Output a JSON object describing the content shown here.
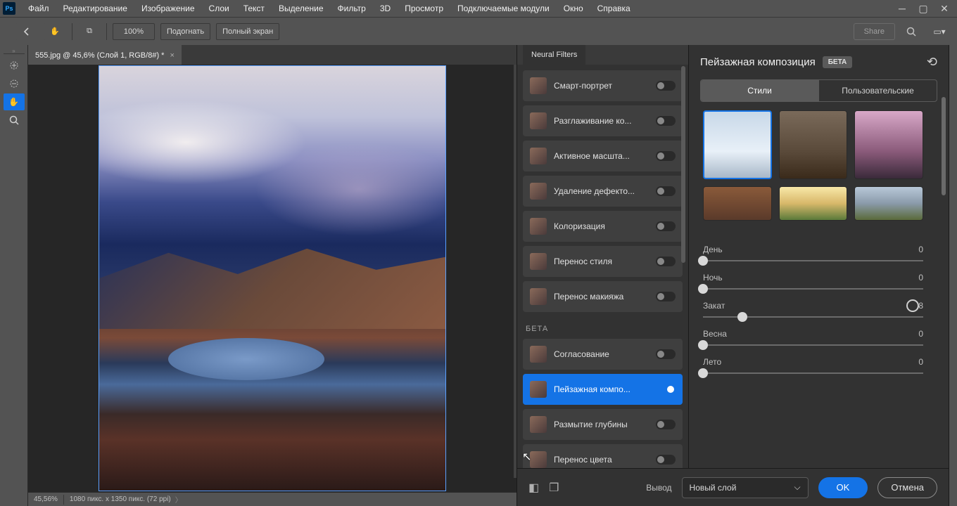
{
  "menu": {
    "items": [
      "Файл",
      "Редактирование",
      "Изображение",
      "Слои",
      "Текст",
      "Выделение",
      "Фильтр",
      "3D",
      "Просмотр",
      "Подключаемые модули",
      "Окно",
      "Справка"
    ]
  },
  "optbar": {
    "zoom": "100%",
    "fit": "Подогнать",
    "full": "Полный экран",
    "share": "Share"
  },
  "tab": {
    "title": "555.jpg @ 45,6% (Слой 1, RGB/8#) *"
  },
  "status": {
    "zoom": "45,56%",
    "dims": "1080 пикс. x 1350 пикс. (72 ppi)"
  },
  "nf": {
    "panel_title": "Neural Filters",
    "items": [
      {
        "label": "Смарт-портрет"
      },
      {
        "label": "Разглаживание ко..."
      },
      {
        "label": "Активное масшта..."
      },
      {
        "label": "Удаление дефекто..."
      },
      {
        "label": "Колоризация"
      },
      {
        "label": "Перенос стиля"
      },
      {
        "label": "Перенос макияжа"
      }
    ],
    "section": "БЕТА",
    "beta_items": [
      {
        "label": "Согласование"
      },
      {
        "label": "Пейзажная компо...",
        "on": true
      },
      {
        "label": "Размытие глубины"
      },
      {
        "label": "Перенос цвета"
      }
    ]
  },
  "right": {
    "title": "Пейзажная композиция",
    "beta": "БЕТА",
    "tabs": {
      "styles": "Стили",
      "custom": "Пользовательские"
    },
    "sliders": [
      {
        "label": "День",
        "value": "0",
        "pos": 0
      },
      {
        "label": "Ночь",
        "value": "0",
        "pos": 0
      },
      {
        "label": "Закат",
        "value": "18",
        "pos": 18
      },
      {
        "label": "Весна",
        "value": "0",
        "pos": 0
      },
      {
        "label": "Лето",
        "value": "0",
        "pos": 0
      }
    ]
  },
  "bottom": {
    "output": "Вывод",
    "select": "Новый слой",
    "ok": "OK",
    "cancel": "Отмена"
  }
}
